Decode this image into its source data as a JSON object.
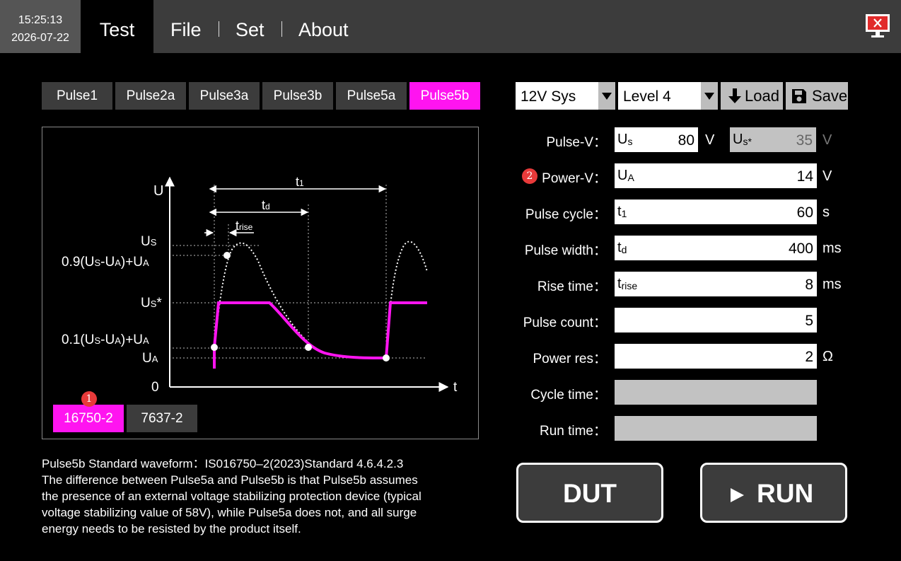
{
  "header": {
    "time": "15:25:13",
    "date": "2026-07-22",
    "menu": [
      "Test",
      "File",
      "Set",
      "About"
    ],
    "screen_icon": "monitor-close-icon"
  },
  "pulse_tabs": [
    "Pulse1",
    "Pulse2a",
    "Pulse3a",
    "Pulse3b",
    "Pulse5a",
    "Pulse5b"
  ],
  "active_pulse": "Pulse5b",
  "diagram": {
    "axis_y": "U",
    "axis_x": "t",
    "origin": "0",
    "label_us": [
      "U",
      "S"
    ],
    "label_09": [
      "0.9(U",
      "S",
      "-U",
      "A",
      ")+U",
      "A"
    ],
    "label_us_star": [
      "U",
      "S",
      "*"
    ],
    "label_01": [
      "0.1(U",
      "S",
      "-U",
      "A",
      ")+U",
      "A"
    ],
    "label_ua": [
      "U",
      "A"
    ],
    "label_t1": [
      "t",
      "1"
    ],
    "label_td": [
      "t",
      "d"
    ],
    "label_trise": [
      "t",
      "rise"
    ],
    "standard_tabs": [
      "16750-2",
      "7637-2"
    ],
    "active_standard": "16750-2",
    "badge": "1"
  },
  "description": [
    "Pulse5b Standard waveform：IS016750–2(2023)Standard 4.6.4.2.3",
    "The difference between Pulse5a and Pulse5b is that Pulse5b assumes",
    "the presence of an external voltage stabilizing protection device (typical",
    "voltage stabilizing value of 58V), while Pulse5a does not, and all surge",
    "energy needs to be resisted by the product itself."
  ],
  "controls": {
    "system": "12V Sys",
    "level": "Level 4",
    "load_label": "Load",
    "save_label": "Save"
  },
  "params": {
    "pulse_v": {
      "label": "Pulse-V：",
      "sym": "U",
      "sub": "s",
      "value": "80",
      "unit": "V",
      "sym2": "U",
      "sub2": "s*",
      "value2": "35",
      "unit2": "V"
    },
    "power_v": {
      "label": "Power-V：",
      "sym": "U",
      "sub": "A",
      "value": "14",
      "unit": "V",
      "badge": "2"
    },
    "pulse_cycle": {
      "label": "Pulse cycle：",
      "sym": "t",
      "sub": "1",
      "value": "60",
      "unit": "s"
    },
    "pulse_width": {
      "label": "Pulse width：",
      "sym": "t",
      "sub": "d",
      "value": "400",
      "unit": "ms"
    },
    "rise_time": {
      "label": "Rise time：",
      "sym": "t",
      "sub": "rise",
      "value": "8",
      "unit": "ms"
    },
    "pulse_count": {
      "label": "Pulse count：",
      "value": "5"
    },
    "power_res": {
      "label": "Power res：",
      "value": "2",
      "unit": "Ω"
    },
    "cycle_time": {
      "label": "Cycle time：",
      "value": ""
    },
    "run_time": {
      "label": "Run time：",
      "value": ""
    }
  },
  "buttons": {
    "dut": "DUT",
    "run": "RUN"
  },
  "colors": {
    "accent": "#ff14f0",
    "panel": "#3c3c3c",
    "badge": "#e83a3a"
  }
}
